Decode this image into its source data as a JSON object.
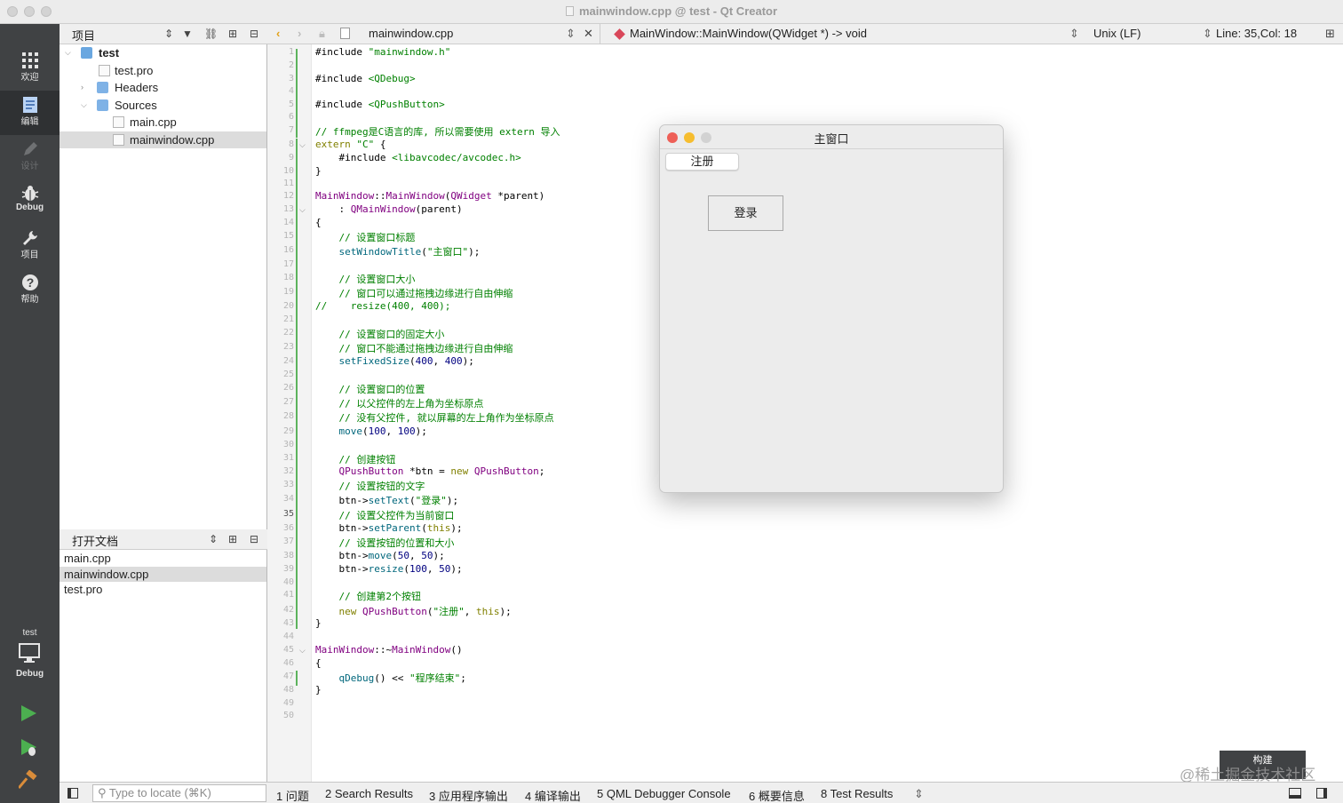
{
  "window": {
    "title": "mainwindow.cpp @ test - Qt Creator"
  },
  "modes": [
    {
      "label": "欢迎",
      "icon": "grid-icon"
    },
    {
      "label": "编辑",
      "icon": "edit-doc-icon"
    },
    {
      "label": "设计",
      "icon": "pencil-icon"
    },
    {
      "label": "Debug",
      "icon": "bug-icon"
    },
    {
      "label": "项目",
      "icon": "wrench-icon"
    },
    {
      "label": "帮助",
      "icon": "help-icon"
    }
  ],
  "kit": {
    "project": "test",
    "config": "Debug"
  },
  "projects": {
    "header": "项目",
    "tree": [
      {
        "label": "test",
        "level": 0,
        "expanded": true,
        "bold": true
      },
      {
        "label": "test.pro",
        "level": 1
      },
      {
        "label": "Headers",
        "level": 1,
        "expanded": false
      },
      {
        "label": "Sources",
        "level": 1,
        "expanded": true
      },
      {
        "label": "main.cpp",
        "level": 2
      },
      {
        "label": "mainwindow.cpp",
        "level": 2,
        "selected": true
      }
    ]
  },
  "open_documents": {
    "header": "打开文档",
    "items": [
      "main.cpp",
      "mainwindow.cpp",
      "test.pro"
    ],
    "selected": "mainwindow.cpp"
  },
  "editor": {
    "file": "mainwindow.cpp",
    "symbol": "MainWindow::MainWindow(QWidget *) -> void",
    "line_ending": "Unix (LF)",
    "position": "Line: 35,Col: 18",
    "current_line": 35,
    "lines": [
      "#include \"mainwindow.h\"",
      "",
      "#include <QDebug>",
      "",
      "#include <QPushButton>",
      "",
      "// ffmpeg是C语言的库, 所以需要使用 extern 导入",
      "extern \"C\" {",
      "    #include <libavcodec/avcodec.h>",
      "}",
      "",
      "MainWindow::MainWindow(QWidget *parent)",
      "    : QMainWindow(parent)",
      "{",
      "    // 设置窗口标题",
      "    setWindowTitle(\"主窗口\");",
      "",
      "    // 设置窗口大小",
      "    // 窗口可以通过拖拽边缘进行自由伸缩",
      "//    resize(400, 400);",
      "",
      "    // 设置窗口的固定大小",
      "    // 窗口不能通过拖拽边缘进行自由伸缩",
      "    setFixedSize(400, 400);",
      "",
      "    // 设置窗口的位置",
      "    // 以父控件的左上角为坐标原点",
      "    // 没有父控件, 就以屏幕的左上角作为坐标原点",
      "    move(100, 100);",
      "",
      "    // 创建按钮",
      "    QPushButton *btn = new QPushButton;",
      "    // 设置按钮的文字",
      "    btn->setText(\"登录\");",
      "    // 设置父控件为当前窗口",
      "    btn->setParent(this);",
      "    // 设置按钮的位置和大小",
      "    btn->move(50, 50);",
      "    btn->resize(100, 50);",
      "",
      "    // 创建第2个按钮",
      "    new QPushButton(\"注册\", this);",
      "}",
      "",
      "MainWindow::~MainWindow()",
      "{",
      "    qDebug() << \"程序结束\";",
      "}",
      "",
      ""
    ]
  },
  "preview": {
    "title": "主窗口",
    "register_button": "注册",
    "login_button": "登录"
  },
  "build_tooltip": "构建",
  "watermark": "@稀土掘金技术社区",
  "status": {
    "locator_placeholder": "Type to locate (⌘K)",
    "tabs": [
      "1  问题",
      "2  Search Results",
      "3  应用程序输出",
      "4  编译输出",
      "5  QML Debugger Console",
      "6  概要信息",
      "8  Test Results"
    ]
  },
  "colors": {
    "sidebar": "#404244",
    "accent_green": "#5db35d",
    "comment": "#008000",
    "keyword": "#808000",
    "type": "#800080"
  }
}
